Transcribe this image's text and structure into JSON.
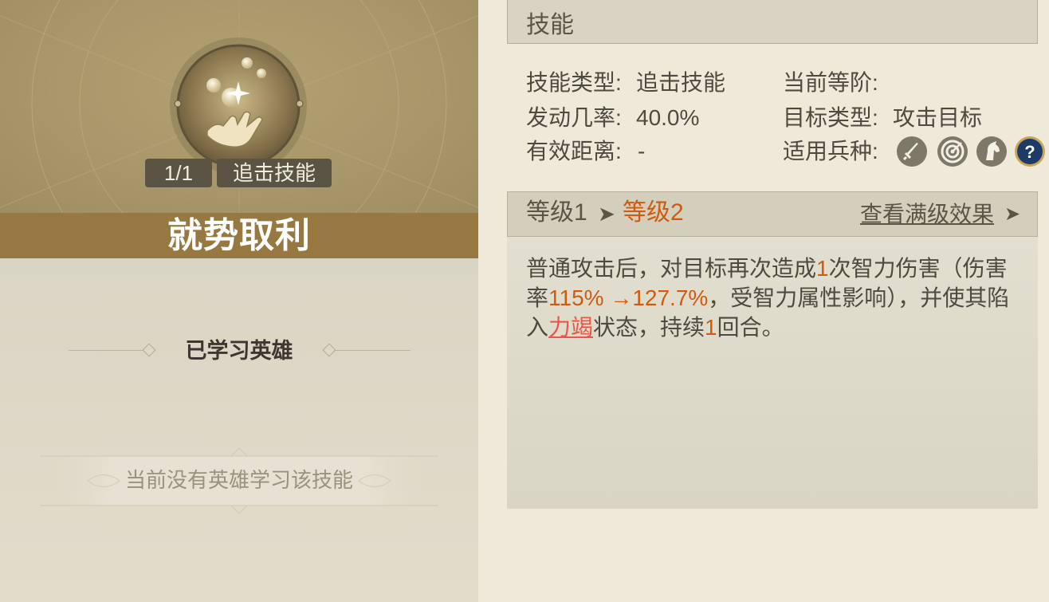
{
  "skill": {
    "count": "1/1",
    "type_badge": "追击技能",
    "name": "就势取利",
    "icon": "hand-holding-orbs-icon"
  },
  "heroes": {
    "section_title": "已学习英雄",
    "empty_text": "当前没有英雄学习该技能"
  },
  "panel": {
    "header": "技能"
  },
  "info": {
    "skill_type_label": "技能类型:",
    "skill_type_value": "追击技能",
    "trigger_rate_label": "发动几率:",
    "trigger_rate_value": "40.0%",
    "range_label": "有效距离:",
    "range_value": "-",
    "current_tier_label": "当前等阶:",
    "target_type_label": "目标类型:",
    "target_type_value": "攻击目标",
    "troop_type_label": "适用兵种:",
    "troop_icons": [
      "sword-icon",
      "bow-target-icon",
      "cavalry-horse-icon",
      "unknown-question-icon"
    ]
  },
  "level": {
    "from": "等级1",
    "arrow": "➤",
    "to": "等级2",
    "max_link": "查看满级效果",
    "max_arrow": "➤"
  },
  "description": {
    "p1": "普通攻击后，对目标再次造成",
    "n1": "1",
    "p2": "次智力伤害（伤害率",
    "rate": "115% →127.7%",
    "p3": "，受智力属性影响），并使其陷入",
    "status": "力竭",
    "p4": "状态，持续",
    "n2": "1",
    "p5": "回合。"
  },
  "colors": {
    "highlight": "#d05a0e",
    "keyword": "#e8574a",
    "name_bar": "#967840"
  }
}
